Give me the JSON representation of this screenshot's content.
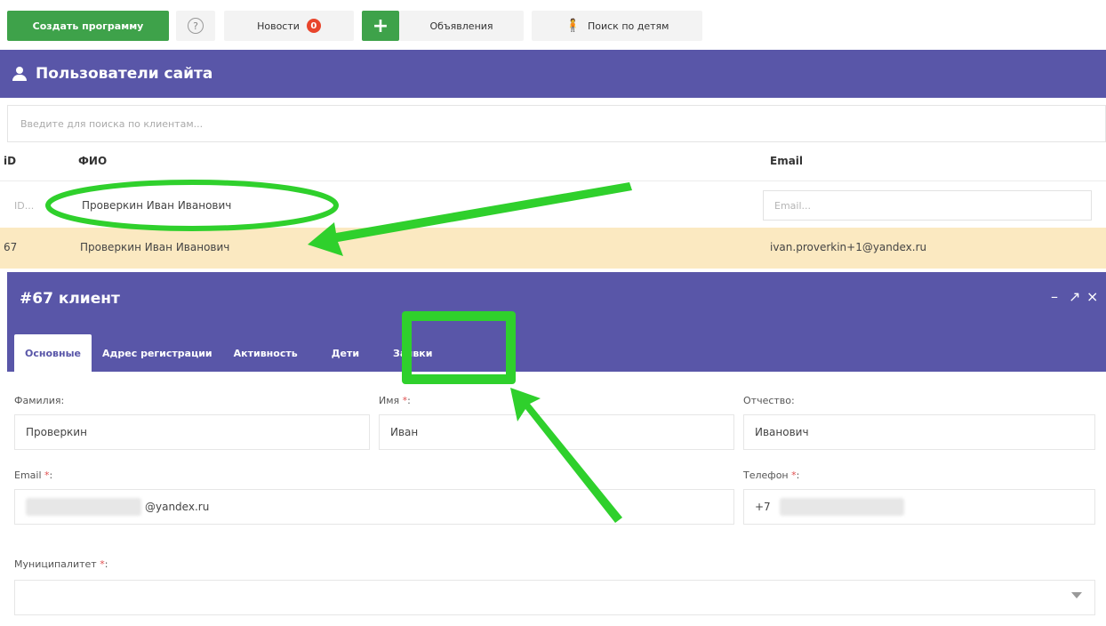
{
  "toolbar": {
    "create_program": "Создать программу",
    "help_glyph": "?",
    "news": "Новости",
    "news_badge": "0",
    "plus": "+",
    "ads": "Объявления",
    "kids_search": "Поиск по детям"
  },
  "users_panel": {
    "title": "Пользователи сайта",
    "search_placeholder": "Введите для поиска по клиентам...",
    "columns": {
      "id": "iD",
      "fio": "ФИО",
      "email": "Email"
    },
    "filters": {
      "id": "ID...",
      "fio": "Проверкин Иван Иванович",
      "email": "Email..."
    },
    "rows": [
      {
        "id": "67",
        "fio": "Проверкин Иван Иванович",
        "email": "ivan.proverkin+1@yandex.ru"
      }
    ]
  },
  "client_modal": {
    "title": "#67 клиент",
    "controls": {
      "minimize": "–",
      "expand": "↗",
      "close": "×"
    },
    "tabs": [
      {
        "label": "Основные",
        "active": true
      },
      {
        "label": "Адрес регистрации",
        "active": false
      },
      {
        "label": "Активность",
        "active": false
      },
      {
        "label": "Дети",
        "active": false
      },
      {
        "label": "Заявки",
        "active": false
      }
    ],
    "fields": {
      "last_name": {
        "label": "Фамилия:",
        "value": "Проверкин"
      },
      "first_name": {
        "label": "Имя",
        "required": "*",
        "colon": ":",
        "value": "Иван"
      },
      "patronymic": {
        "label": "Отчество:",
        "value": "Иванович"
      },
      "email": {
        "label": "Email",
        "required": "*",
        "colon": ":",
        "value": "@yandex.ru"
      },
      "phone": {
        "label": "Телефон",
        "required": "*",
        "colon": ":",
        "value": "+7"
      },
      "municipality": {
        "label": "Муниципалитет",
        "required": "*",
        "colon": ":",
        "value": ""
      }
    }
  },
  "colors": {
    "header_purple": "#5956a8",
    "button_green": "#3ea24a",
    "highlight_row": "#fbe9c1",
    "annotation_green": "#2fd02c",
    "badge_red": "#e8452c"
  }
}
